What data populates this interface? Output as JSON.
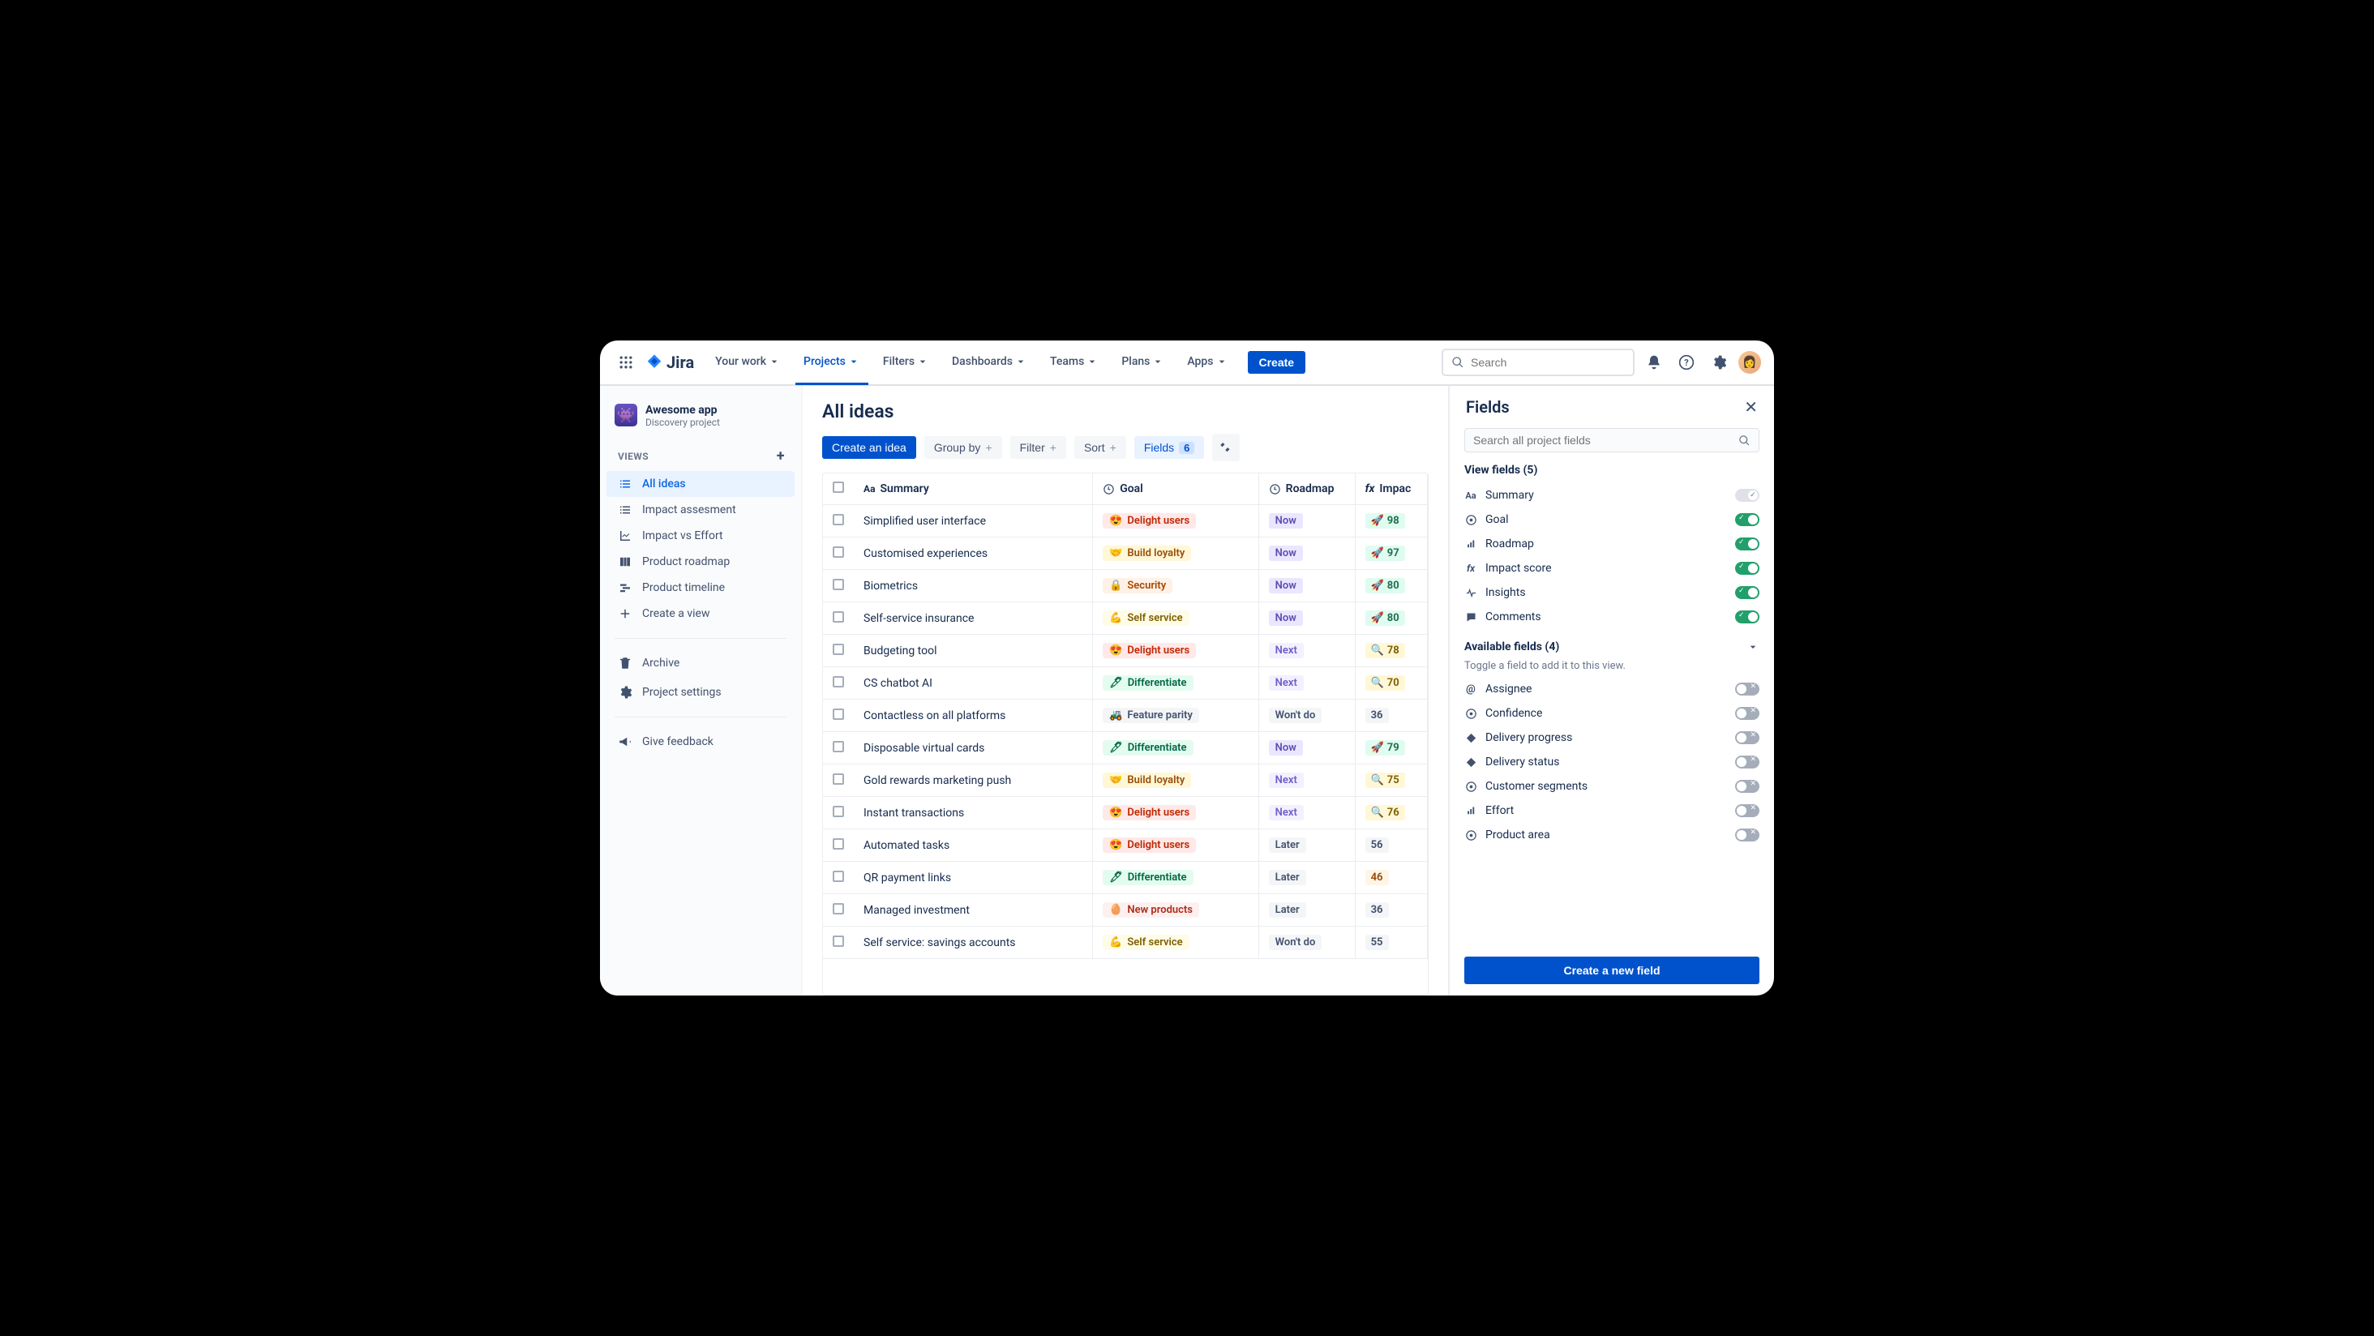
{
  "nav": {
    "brand": "Jira",
    "items": [
      "Your work",
      "Projects",
      "Filters",
      "Dashboards",
      "Teams",
      "Plans",
      "Apps"
    ],
    "active": 1,
    "create": "Create",
    "search_placeholder": "Search"
  },
  "project": {
    "name": "Awesome app",
    "type": "Discovery project"
  },
  "sidebar": {
    "views_label": "VIEWS",
    "views": [
      "All ideas",
      "Impact assesment",
      "Impact vs Effort",
      "Product roadmap",
      "Product timeline",
      "Create a view"
    ],
    "view_icons": [
      "list",
      "list",
      "chart",
      "columns",
      "timeline",
      "plus"
    ],
    "active": 0,
    "archive": "Archive",
    "settings": "Project settings",
    "feedback": "Give feedback"
  },
  "page": {
    "title": "All ideas"
  },
  "toolbar": {
    "create_idea": "Create an idea",
    "group_by": "Group by",
    "filter": "Filter",
    "sort": "Sort",
    "fields": "Fields",
    "fields_count": "6"
  },
  "columns": {
    "summary": "Summary",
    "goal": "Goal",
    "roadmap": "Roadmap",
    "impact": "Impac"
  },
  "rows": [
    {
      "summary": "Simplified user interface",
      "goal": "Delight users",
      "goal_c": "delight",
      "roadmap": "Now",
      "rm_c": "now",
      "impact": "98",
      "imp_c": "high"
    },
    {
      "summary": "Customised experiences",
      "goal": "Build loyalty",
      "goal_c": "loyalty",
      "roadmap": "Now",
      "rm_c": "now",
      "impact": "97",
      "imp_c": "high"
    },
    {
      "summary": "Biometrics",
      "goal": "Security",
      "goal_c": "security",
      "roadmap": "Now",
      "rm_c": "now",
      "impact": "80",
      "imp_c": "high"
    },
    {
      "summary": "Self-service insurance",
      "goal": "Self service",
      "goal_c": "selfservice",
      "roadmap": "Now",
      "rm_c": "now",
      "impact": "80",
      "imp_c": "high"
    },
    {
      "summary": "Budgeting tool",
      "goal": "Delight users",
      "goal_c": "delight",
      "roadmap": "Next",
      "rm_c": "next",
      "impact": "78",
      "imp_c": "med2"
    },
    {
      "summary": "CS chatbot AI",
      "goal": "Differentiate",
      "goal_c": "differentiate",
      "roadmap": "Next",
      "rm_c": "next",
      "impact": "70",
      "imp_c": "med2"
    },
    {
      "summary": "Contactless on all platforms",
      "goal": "Feature parity",
      "goal_c": "parity",
      "roadmap": "Won't do",
      "rm_c": "wont",
      "impact": "36",
      "imp_c": "plain"
    },
    {
      "summary": "Disposable virtual cards",
      "goal": "Differentiate",
      "goal_c": "differentiate",
      "roadmap": "Now",
      "rm_c": "now",
      "impact": "79",
      "imp_c": "high"
    },
    {
      "summary": "Gold rewards marketing push",
      "goal": "Build loyalty",
      "goal_c": "loyalty",
      "roadmap": "Next",
      "rm_c": "next",
      "impact": "75",
      "imp_c": "med2"
    },
    {
      "summary": "Instant transactions",
      "goal": "Delight users",
      "goal_c": "delight",
      "roadmap": "Next",
      "rm_c": "next",
      "impact": "76",
      "imp_c": "med2"
    },
    {
      "summary": "Automated tasks",
      "goal": "Delight users",
      "goal_c": "delight",
      "roadmap": "Later",
      "rm_c": "later",
      "impact": "56",
      "imp_c": "plain"
    },
    {
      "summary": "QR payment links",
      "goal": "Differentiate",
      "goal_c": "differentiate",
      "roadmap": "Later",
      "rm_c": "later",
      "impact": "46",
      "imp_c": "low"
    },
    {
      "summary": "Managed investment",
      "goal": "New products",
      "goal_c": "newproducts",
      "roadmap": "Later",
      "rm_c": "later",
      "impact": "36",
      "imp_c": "plain"
    },
    {
      "summary": "Self service: savings accounts",
      "goal": "Self service",
      "goal_c": "selfservice",
      "roadmap": "Won't do",
      "rm_c": "wont",
      "impact": "55",
      "imp_c": "plain"
    }
  ],
  "panel": {
    "title": "Fields",
    "search_placeholder": "Search all project fields",
    "view_fields_label": "View fields (5)",
    "available_fields_label": "Available fields (4)",
    "available_hint": "Toggle a field to add it to this view.",
    "view_fields": [
      {
        "icon": "text",
        "label": "Summary",
        "toggle": "pinned"
      },
      {
        "icon": "target",
        "label": "Goal",
        "toggle": "on"
      },
      {
        "icon": "bars",
        "label": "Roadmap",
        "toggle": "on"
      },
      {
        "icon": "fx",
        "label": "Impact score",
        "toggle": "on"
      },
      {
        "icon": "pulse",
        "label": "Insights",
        "toggle": "on"
      },
      {
        "icon": "comment",
        "label": "Comments",
        "toggle": "on"
      }
    ],
    "available_fields": [
      {
        "icon": "at",
        "label": "Assignee",
        "toggle": "off"
      },
      {
        "icon": "target",
        "label": "Confidence",
        "toggle": "off"
      },
      {
        "icon": "diamond",
        "label": "Delivery progress",
        "toggle": "off"
      },
      {
        "icon": "diamond",
        "label": "Delivery status",
        "toggle": "off"
      },
      {
        "icon": "target",
        "label": "Customer segments",
        "toggle": "off"
      },
      {
        "icon": "bars",
        "label": "Effort",
        "toggle": "off"
      },
      {
        "icon": "target",
        "label": "Product area",
        "toggle": "off"
      }
    ],
    "create_field": "Create a new field"
  }
}
